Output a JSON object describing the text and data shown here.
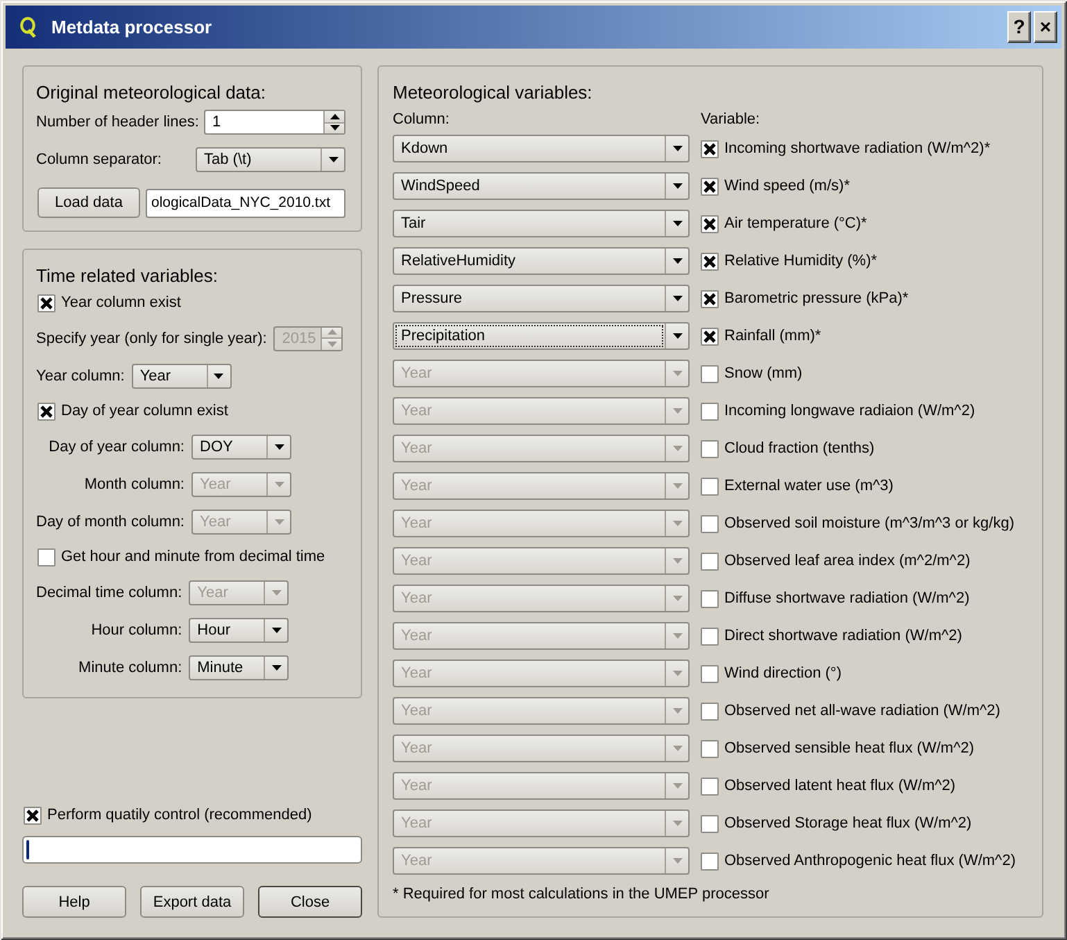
{
  "window": {
    "title": "Metdata processor",
    "title_buttons": [
      "?",
      "×"
    ]
  },
  "original_data": {
    "title": "Original meteorological data:",
    "header_lines": {
      "label": "Number of header lines:",
      "value": "1"
    },
    "separator": {
      "label": "Column separator:",
      "value": "Tab (\\t)"
    },
    "load_button": "Load data",
    "file_path": "ologicalData_NYC_2010.txt"
  },
  "time_variables": {
    "title": "Time related variables:",
    "items": [
      {
        "kind": "checkbox",
        "label": "Year column exist",
        "checked": true
      },
      {
        "kind": "form",
        "fields": [
          {
            "kind": "spin",
            "label": "Specify year (only for single year):",
            "value": "2015",
            "disabled": true
          }
        ]
      },
      {
        "kind": "form",
        "fields": [
          {
            "kind": "combo",
            "label": "Year column:",
            "value": "Year",
            "disabled": false
          }
        ]
      },
      {
        "kind": "checkbox",
        "label": "Day of year column exist",
        "checked": true
      },
      {
        "kind": "form",
        "fields": [
          {
            "kind": "combo",
            "label": "Day of year column:",
            "value": "DOY",
            "disabled": false
          },
          {
            "kind": "combo",
            "label": "Month column:",
            "value": "Year",
            "disabled": true
          },
          {
            "kind": "combo",
            "label": "Day of month column:",
            "value": "Year",
            "disabled": true
          }
        ]
      },
      {
        "kind": "checkbox",
        "label": "Get hour and minute from decimal time",
        "checked": false
      },
      {
        "kind": "form",
        "fields": [
          {
            "kind": "combo",
            "label": "Decimal time column:",
            "value": "Year",
            "disabled": true
          },
          {
            "kind": "combo",
            "label": "Hour column:",
            "value": "Hour",
            "disabled": false
          },
          {
            "kind": "combo",
            "label": "Minute column:",
            "value": "Minute",
            "disabled": false
          }
        ]
      }
    ]
  },
  "quality_control": {
    "label": "Perform quatily control (recommended)",
    "checked": true
  },
  "progress": {
    "level": 0.01
  },
  "buttons": [
    {
      "label": "Help",
      "default": false
    },
    {
      "label": "Export data",
      "default": false
    },
    {
      "label": "Close",
      "default": true
    }
  ],
  "meteorological": {
    "title": "Meteorological variables:",
    "column_heading": "Column:",
    "variable_heading": "Variable:",
    "rows": [
      {
        "column": "Kdown",
        "disabled": false,
        "focused": false,
        "variable": "Incoming shortwave radiation (W/m^2)*",
        "checked": true
      },
      {
        "column": "WindSpeed",
        "disabled": false,
        "focused": false,
        "variable": "Wind speed (m/s)*",
        "checked": true
      },
      {
        "column": "Tair",
        "disabled": false,
        "focused": false,
        "variable": "Air temperature (°C)*",
        "checked": true
      },
      {
        "column": "RelativeHumidity",
        "disabled": false,
        "focused": false,
        "variable": "Relative Humidity (%)*",
        "checked": true
      },
      {
        "column": "Pressure",
        "disabled": false,
        "focused": false,
        "variable": "Barometric pressure (kPa)*",
        "checked": true
      },
      {
        "column": "Precipitation",
        "disabled": false,
        "focused": true,
        "variable": "Rainfall (mm)*",
        "checked": true
      },
      {
        "column": "Year",
        "disabled": true,
        "focused": false,
        "variable": "Snow (mm)",
        "checked": false
      },
      {
        "column": "Year",
        "disabled": true,
        "focused": false,
        "variable": "Incoming longwave radiaion (W/m^2)",
        "checked": false
      },
      {
        "column": "Year",
        "disabled": true,
        "focused": false,
        "variable": "Cloud fraction (tenths)",
        "checked": false
      },
      {
        "column": "Year",
        "disabled": true,
        "focused": false,
        "variable": "External water use (m^3)",
        "checked": false
      },
      {
        "column": "Year",
        "disabled": true,
        "focused": false,
        "variable": "Observed soil moisture (m^3/m^3 or kg/kg)",
        "checked": false
      },
      {
        "column": "Year",
        "disabled": true,
        "focused": false,
        "variable": "Observed leaf area index (m^2/m^2)",
        "checked": false
      },
      {
        "column": "Year",
        "disabled": true,
        "focused": false,
        "variable": "Diffuse shortwave radiation (W/m^2)",
        "checked": false
      },
      {
        "column": "Year",
        "disabled": true,
        "focused": false,
        "variable": "Direct shortwave radiation (W/m^2)",
        "checked": false
      },
      {
        "column": "Year",
        "disabled": true,
        "focused": false,
        "variable": "Wind direction (°)",
        "checked": false
      },
      {
        "column": "Year",
        "disabled": true,
        "focused": false,
        "variable": "Observed net all-wave radiation (W/m^2)",
        "checked": false
      },
      {
        "column": "Year",
        "disabled": true,
        "focused": false,
        "variable": "Observed sensible heat flux (W/m^2)",
        "checked": false
      },
      {
        "column": "Year",
        "disabled": true,
        "focused": false,
        "variable": "Observed latent heat flux (W/m^2)",
        "checked": false
      },
      {
        "column": "Year",
        "disabled": true,
        "focused": false,
        "variable": "Observed Storage heat flux (W/m^2)",
        "checked": false
      },
      {
        "column": "Year",
        "disabled": true,
        "focused": false,
        "variable": "Observed Anthropogenic heat flux (W/m^2)",
        "checked": false
      }
    ],
    "footnote": "* Required for most calculations in the UMEP processor"
  }
}
